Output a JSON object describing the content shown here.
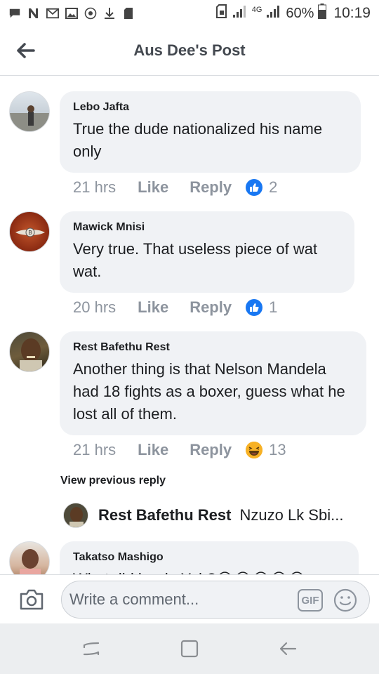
{
  "status_bar": {
    "network": "4G",
    "battery": "60%",
    "time": "10:19"
  },
  "header": {
    "title": "Aus Dee's Post",
    "back_icon": "arrow-left-icon"
  },
  "comments": [
    {
      "author": "Lebo Jafta",
      "text": "True the dude nationalized his name only",
      "time": "21 hrs",
      "like_label": "Like",
      "reply_label": "Reply",
      "reaction": "like",
      "reaction_count": "2"
    },
    {
      "author": "Mawick Mnisi",
      "text": "Very true. That useless piece of wat wat.",
      "time": "20 hrs",
      "like_label": "Like",
      "reply_label": "Reply",
      "reaction": "like",
      "reaction_count": "1"
    },
    {
      "author": "Rest Bafethu Rest",
      "text": "Another thing is that Nelson Mandela had 18 fights as a boxer, guess what he lost all of them.",
      "time": "21 hrs",
      "like_label": "Like",
      "reply_label": "Reply",
      "reaction": "haha",
      "reaction_count": "13"
    },
    {
      "author": "Takatso Mashigo",
      "text": "What did he do Yah?😂😂😂😂😂"
    }
  ],
  "view_previous": "View previous reply",
  "reply_preview": {
    "author": "Rest Bafethu Rest",
    "snippet": "Nzuzo Lk Sbi..."
  },
  "composer": {
    "placeholder": "Write a comment...",
    "gif_label": "GIF"
  },
  "colors": {
    "like_blue": "#1877f2",
    "bubble_bg": "#f0f2f5",
    "meta_gray": "#8d949e"
  }
}
